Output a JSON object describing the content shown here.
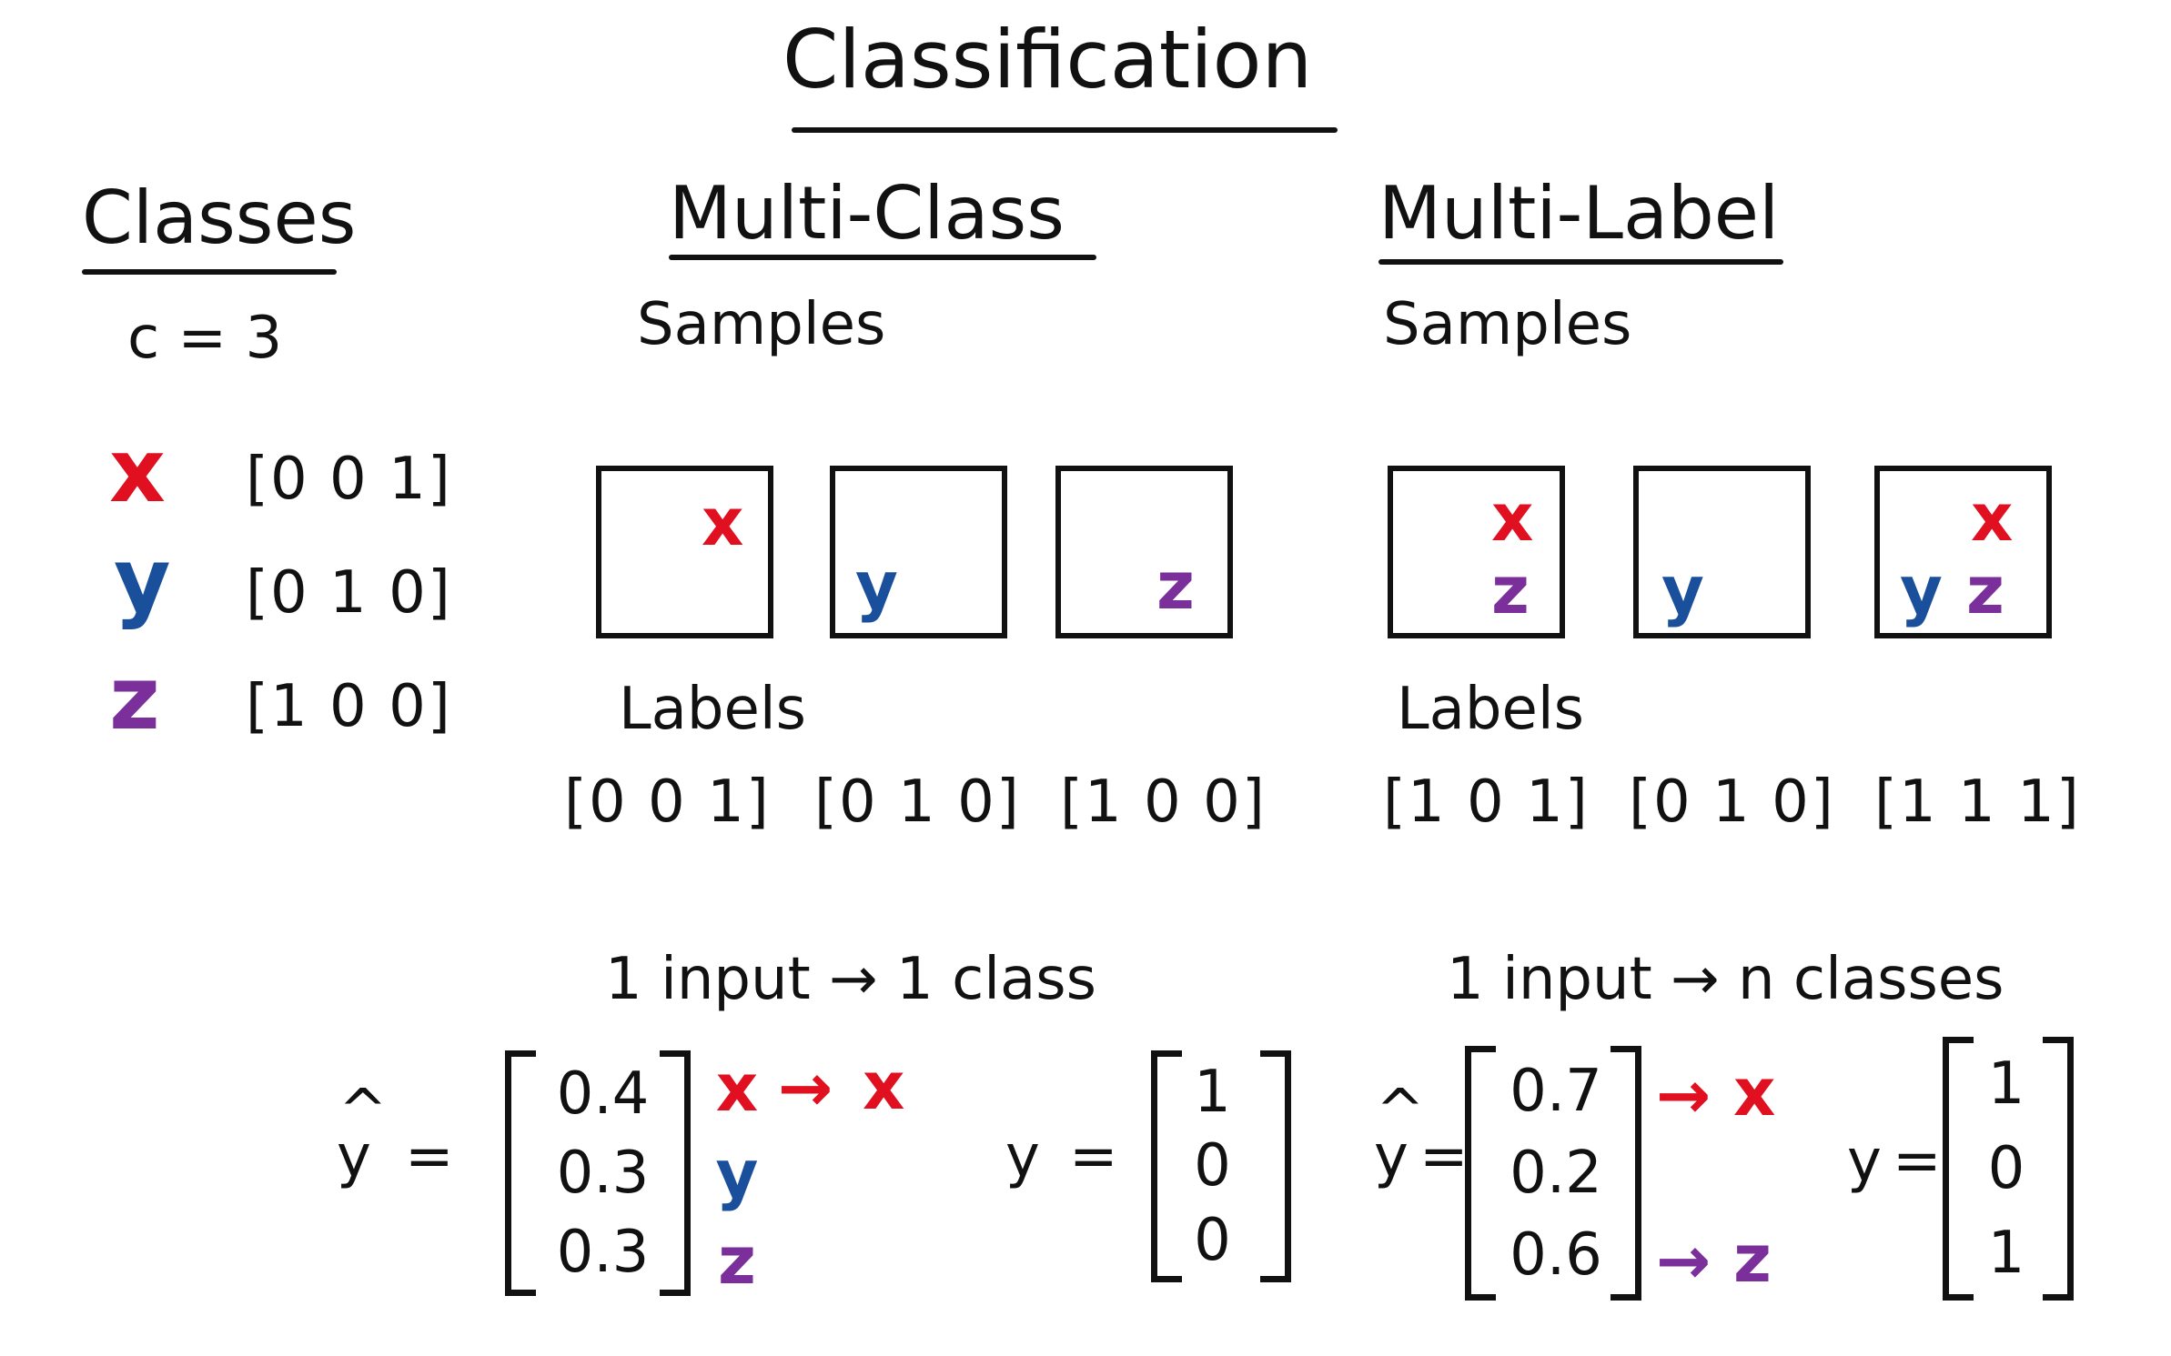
{
  "title": "Classification",
  "classes_section": {
    "heading": "Classes",
    "count_text": "c = 3",
    "items": [
      {
        "symbol": "x",
        "vector": "[0 0 1]",
        "color": "#e01020"
      },
      {
        "symbol": "y",
        "vector": "[0 1 0]",
        "color": "#1a4f9c"
      },
      {
        "symbol": "z",
        "vector": "[1 0 0]",
        "color": "#7a2f9a"
      }
    ]
  },
  "multi_class": {
    "heading": "Multi-Class",
    "samples_label": "Samples",
    "samples": [
      {
        "symbols": "x"
      },
      {
        "symbols": "y"
      },
      {
        "symbols": "z"
      }
    ],
    "labels_label": "Labels",
    "labels": [
      "[0 0 1]",
      "[0 1 0]",
      "[1 0 0]"
    ],
    "rule": "1 input → 1 class",
    "prediction": {
      "yhat_label": "y",
      "equals": "=",
      "values": [
        "0.4",
        "0.3",
        "0.3"
      ],
      "class_symbols": [
        "x",
        "y",
        "z"
      ],
      "arrow": "→",
      "predicted": "x"
    },
    "target": {
      "y_label": "y",
      "equals": "=",
      "values": [
        "1",
        "0",
        "0"
      ]
    }
  },
  "multi_label": {
    "heading": "Multi-Label",
    "samples_label": "Samples",
    "samples": [
      {
        "top": "x",
        "bottom": "z"
      },
      {
        "bottom": "y"
      },
      {
        "top": "x",
        "bottom_left": "y",
        "bottom_right": "z"
      }
    ],
    "labels_label": "Labels",
    "labels": [
      "[1 0 1]",
      "[0 1 0]",
      "[1 1 1]"
    ],
    "rule": "1 input → n classes",
    "prediction": {
      "yhat_label": "y",
      "equals": "=",
      "values": [
        "0.7",
        "0.2",
        "0.6"
      ],
      "arrow": "→",
      "predicted_first": "x",
      "predicted_third": "z"
    },
    "target": {
      "y_label": "y",
      "equals": "=",
      "values": [
        "1",
        "0",
        "1"
      ]
    }
  },
  "colors": {
    "ink": "#111111",
    "x": "#e01020",
    "y": "#1a4f9c",
    "z": "#7a2f9a"
  }
}
